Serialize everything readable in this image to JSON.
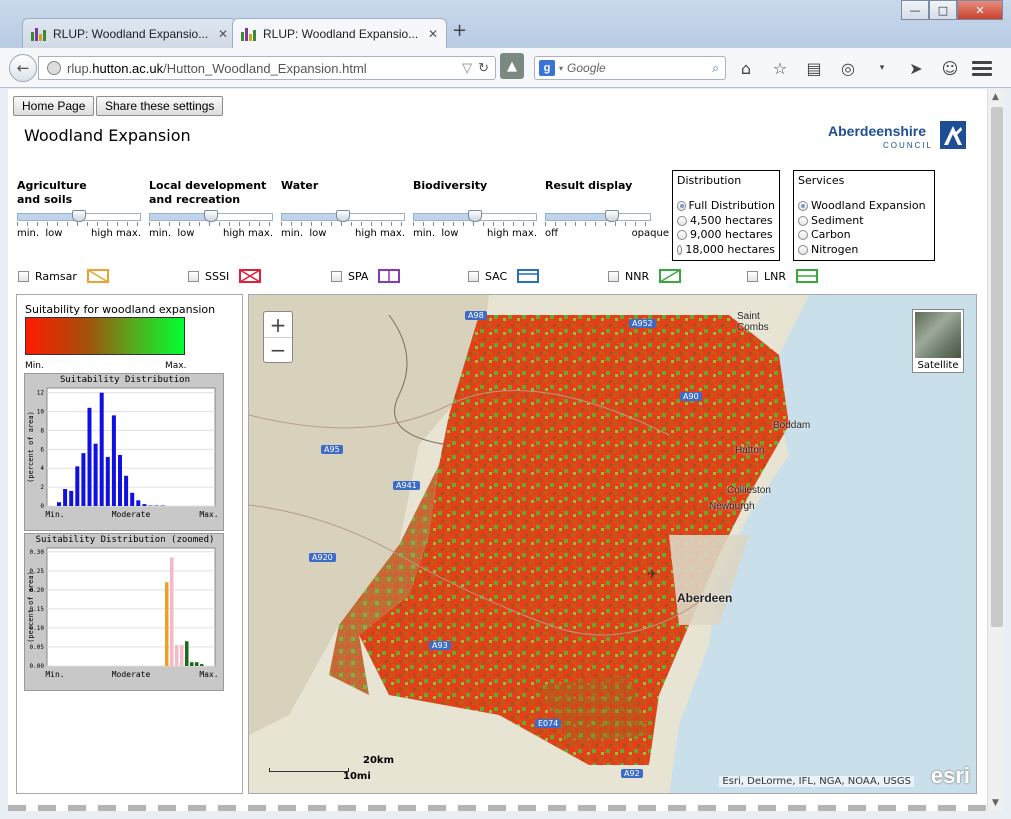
{
  "browser": {
    "tabs": [
      {
        "title": "RLUP: Woodland Expansio...",
        "active": false
      },
      {
        "title": "RLUP: Woodland Expansio...",
        "active": true
      }
    ],
    "url_prefix": "rlup.",
    "url_host": "hutton.ac.uk",
    "url_path": "/Hutton_Woodland_Expansion.html",
    "search_engine": "g",
    "search_placeholder": "Google"
  },
  "page": {
    "home_button": "Home Page",
    "share_button": "Share these settings",
    "title": "Woodland Expansion",
    "logo_name": "Aberdeenshire",
    "logo_sub": "COUNCIL"
  },
  "sliders": [
    {
      "label_line1": "Agriculture",
      "label_line2": "and soils",
      "ends": [
        "min.",
        "low",
        "high",
        "max."
      ],
      "level": 0.5
    },
    {
      "label_line1": "Local development",
      "label_line2": "and recreation",
      "ends": [
        "min.",
        "low",
        "high",
        "max."
      ],
      "level": 0.5
    },
    {
      "label_line1": "Water",
      "label_line2": "",
      "ends": [
        "min.",
        "low",
        "high",
        "max."
      ],
      "level": 0.5
    },
    {
      "label_line1": "Biodiversity",
      "label_line2": "",
      "ends": [
        "min.",
        "low",
        "high",
        "max."
      ],
      "level": 0.5
    },
    {
      "label_line1": "Result display",
      "label_line2": "",
      "ends": [
        "off",
        "",
        "",
        "opaque"
      ],
      "level": 0.63
    }
  ],
  "distribution": {
    "legend": "Distribution",
    "options": [
      "Full Distribution",
      "4,500 hectares",
      "9,000 hectares",
      "18,000 hectares"
    ],
    "selected": 0
  },
  "services": {
    "legend": "Services",
    "options": [
      "Woodland Expansion",
      "Sediment",
      "Carbon",
      "Nitrogen"
    ],
    "selected": 0
  },
  "layers": [
    {
      "label": "Ramsar",
      "color": "#f0a030"
    },
    {
      "label": "SSSI",
      "color": "#e0203a"
    },
    {
      "label": "SPA",
      "color": "#8a3ab0"
    },
    {
      "label": "SAC",
      "color": "#2a6fb8"
    },
    {
      "label": "NNR",
      "color": "#3aa840"
    },
    {
      "label": "LNR",
      "color": "#3aa840"
    }
  ],
  "legend": {
    "title": "Suitability for woodland expansion",
    "min": "Min.",
    "max": "Max."
  },
  "chart_data": [
    {
      "type": "bar",
      "title": "Suitability Distribution",
      "ylabel": "(percent of area)",
      "xticks": [
        "Min.",
        "Moderate",
        "Max."
      ],
      "yticks": [
        0,
        2,
        4,
        6,
        8,
        10,
        12
      ],
      "ylim": [
        0,
        12.5
      ],
      "color": "#1010e0",
      "values": [
        0.4,
        1.8,
        1.6,
        4.2,
        5.6,
        10.4,
        6.6,
        12,
        5.2,
        9.6,
        5.4,
        3.2,
        1.4,
        0.6,
        0.2,
        0.05,
        0.05,
        0.05
      ]
    },
    {
      "type": "bar",
      "title": "Suitability Distribution (zoomed)",
      "ylabel": "(percent of area)",
      "xticks": [
        "Min.",
        "Moderate",
        "Max."
      ],
      "yticks": [
        0.0,
        0.05,
        0.1,
        0.15,
        0.2,
        0.25,
        0.3
      ],
      "ylim": [
        0,
        0.31
      ],
      "bars": [
        {
          "value": 0.22,
          "color": "#f0a020"
        },
        {
          "value": 0.285,
          "color": "#f5b8c8"
        },
        {
          "value": 0.055,
          "color": "#f5b8c8"
        },
        {
          "value": 0.055,
          "color": "#f5b8c8"
        },
        {
          "value": 0.065,
          "color": "#1a6a1a"
        },
        {
          "value": 0.01,
          "color": "#1a6a1a"
        },
        {
          "value": 0.01,
          "color": "#1a6a1a"
        },
        {
          "value": 0.005,
          "color": "#1a6a1a"
        }
      ]
    }
  ],
  "map": {
    "basemap_button": "Satellite",
    "attribution": "Esri, DeLorme, IFL, NGA, NOAA, USGS",
    "logo": "esri",
    "scale_km": "20km",
    "scale_mi": "10mi",
    "places": [
      {
        "name": "Saint",
        "line2": "Combs"
      },
      {
        "name": "Boddam"
      },
      {
        "name": "Hatton"
      },
      {
        "name": "Collieston"
      },
      {
        "name": "Newburgh"
      },
      {
        "name": "Aberdeen"
      }
    ],
    "roads": [
      "A98",
      "A95",
      "A941",
      "A920",
      "A93",
      "E074",
      "A92",
      "A90",
      "A952"
    ]
  }
}
